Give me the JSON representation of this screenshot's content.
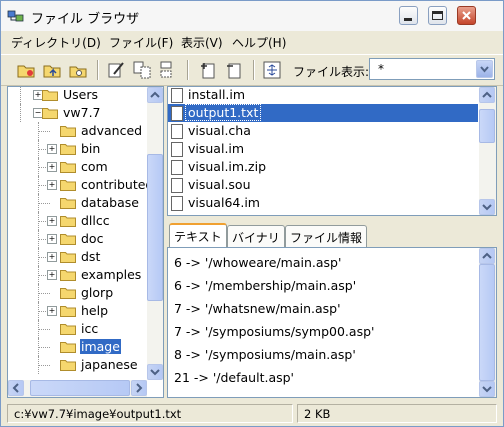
{
  "window": {
    "title": "ファイル ブラウザ"
  },
  "menu": [
    "ディレクトリ(D)",
    "ファイル(F)",
    "表示(V)",
    "ヘルプ(H)"
  ],
  "toolbar": {
    "filter_label": "ファイル表示:",
    "filter_value": "*"
  },
  "tree": {
    "items": [
      {
        "label": "Users",
        "depth": 1,
        "expander": "+",
        "selected": false
      },
      {
        "label": "vw7.7",
        "depth": 1,
        "expander": "-",
        "selected": false
      },
      {
        "label": "advanced",
        "depth": 2,
        "expander": "",
        "selected": false
      },
      {
        "label": "bin",
        "depth": 2,
        "expander": "+",
        "selected": false
      },
      {
        "label": "com",
        "depth": 2,
        "expander": "+",
        "selected": false
      },
      {
        "label": "contributed",
        "depth": 2,
        "expander": "+",
        "selected": false
      },
      {
        "label": "database",
        "depth": 2,
        "expander": "",
        "selected": false
      },
      {
        "label": "dllcc",
        "depth": 2,
        "expander": "+",
        "selected": false
      },
      {
        "label": "doc",
        "depth": 2,
        "expander": "+",
        "selected": false
      },
      {
        "label": "dst",
        "depth": 2,
        "expander": "+",
        "selected": false
      },
      {
        "label": "examples",
        "depth": 2,
        "expander": "+",
        "selected": false
      },
      {
        "label": "glorp",
        "depth": 2,
        "expander": "",
        "selected": false
      },
      {
        "label": "help",
        "depth": 2,
        "expander": "+",
        "selected": false
      },
      {
        "label": "icc",
        "depth": 2,
        "expander": "",
        "selected": false
      },
      {
        "label": "image",
        "depth": 2,
        "expander": "",
        "selected": true
      },
      {
        "label": "japanese",
        "depth": 2,
        "expander": "",
        "selected": false
      }
    ]
  },
  "files": [
    {
      "name": "install.im",
      "selected": false
    },
    {
      "name": "output1.txt",
      "selected": true
    },
    {
      "name": "visual.cha",
      "selected": false
    },
    {
      "name": "visual.im",
      "selected": false
    },
    {
      "name": "visual.im.zip",
      "selected": false
    },
    {
      "name": "visual.sou",
      "selected": false
    },
    {
      "name": "visual64.im",
      "selected": false
    }
  ],
  "tabs": [
    "テキスト",
    "バイナリ",
    "ファイル情報"
  ],
  "content_lines": [
    "6 -> '/whoweare/main.asp'",
    "6 -> '/membership/main.asp'",
    "7 -> '/whatsnew/main.asp'",
    "7 -> '/symposiums/symp00.asp'",
    "8 -> '/symposiums/main.asp'",
    "21 -> '/default.asp'"
  ],
  "status": {
    "path": "c:¥vw7.7¥image¥output1.txt",
    "size": "2 KB"
  },
  "colors": {
    "selection": "#316ac5",
    "folder": "#f5d76e"
  }
}
